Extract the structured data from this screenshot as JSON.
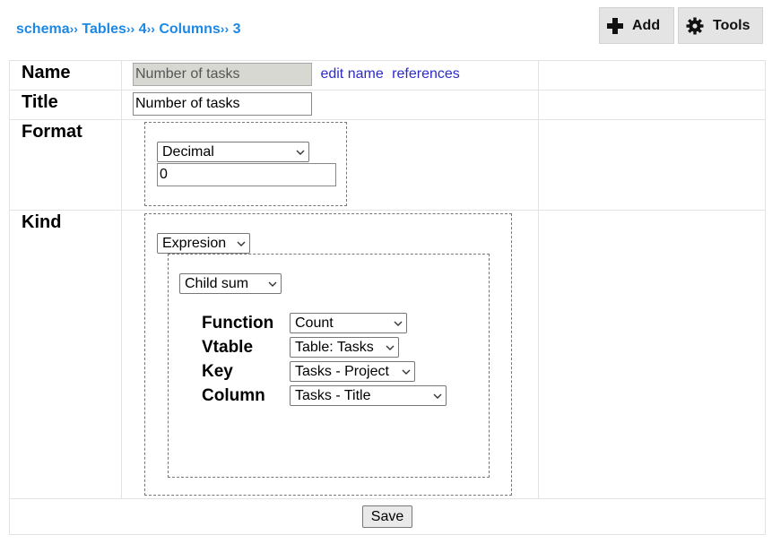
{
  "breadcrumb": {
    "items": [
      "schema",
      "Tables",
      "4",
      "Columns",
      "3"
    ],
    "separator": "››"
  },
  "toolbar": {
    "add_label": "Add",
    "tools_label": "Tools"
  },
  "form": {
    "name": {
      "label": "Name",
      "value": "Number of tasks",
      "edit_link": "edit name",
      "references_link": "references"
    },
    "title": {
      "label": "Title",
      "value": "Number of tasks"
    },
    "format": {
      "label": "Format",
      "type_selected": "Decimal",
      "value": "0"
    },
    "kind": {
      "label": "Kind",
      "kind_selected": "Expresion",
      "expression_selected": "Child sum",
      "function_label": "Function",
      "function_value": "Count",
      "vtable_label": "Vtable",
      "vtable_value": "Table: Tasks",
      "key_label": "Key",
      "key_value": "Tasks - Project",
      "column_label": "Column",
      "column_value": "Tasks - Title"
    },
    "save_label": "Save"
  },
  "colors": {
    "link": "#1e88e5",
    "inline_link": "#2b2bc8",
    "toolbar_bg": "#e4e4e4"
  },
  "icons": {
    "add": "plus-icon",
    "tools": "gear-icon",
    "dropdown": "chevron-down-icon"
  }
}
